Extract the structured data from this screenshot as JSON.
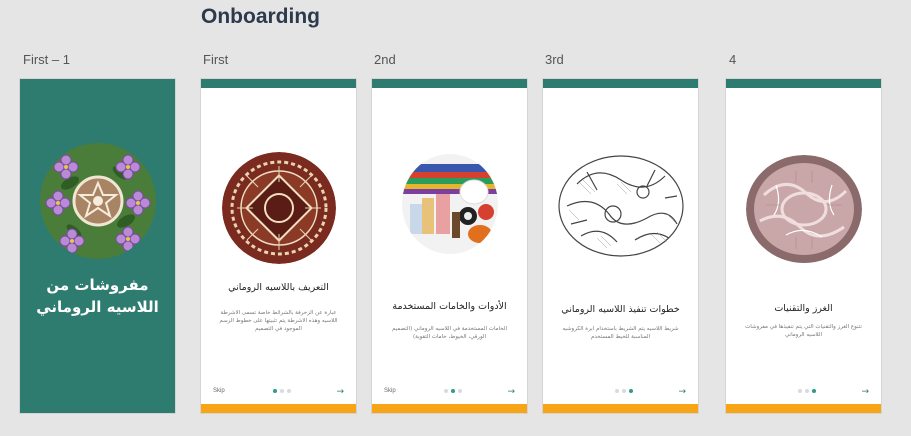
{
  "page": {
    "title": "Onboarding"
  },
  "frames": [
    {
      "label": "First – 1"
    },
    {
      "label": "First"
    },
    {
      "label": "2nd"
    },
    {
      "label": "3rd"
    },
    {
      "label": "4"
    }
  ],
  "splash": {
    "title": "مفروشات من اللاسيه الروماني",
    "image": "lace-flowers-doily"
  },
  "screens": [
    {
      "title": "التعريف باللاسيه الروماني",
      "description": "عبارة عن الزخرفة بالشرائط خاصة تسمى الاشرطة اللاسيه وهذه الاشرطة يتم تثبيتها على خطوط الرسم الموجود في التصميم",
      "skip": "Skip",
      "active_dot": 0,
      "image": "brown-lace-doily"
    },
    {
      "title": "الأدوات والخامات المستخدمة",
      "description": "الخامات المستخدمة في اللاسيه الروماني (التصميم الورقي، الخيوط، خامات التقوية)",
      "skip": "Skip",
      "active_dot": 1,
      "image": "thread-spools"
    },
    {
      "title": "خطوات تنفيذ اللاسيه الروماني",
      "description": "شريط اللاسيه يتم الشريط باستخدام ابرة الكروشيه المناسبة للخيط المستخدم",
      "skip": "",
      "active_dot": 2,
      "image": "lace-pattern-drawing"
    },
    {
      "title": "الغرز والتقنيات",
      "description": "تتنوع الغرز والتقنيات التي يتم تنفيذها في مفروشات اللاسيه الروماني",
      "skip": "",
      "active_dot": 2,
      "image": "pink-lace-piece"
    }
  ],
  "nav": {
    "next_icon": "arrow-right-icon",
    "next_glyph": "→"
  },
  "colors": {
    "teal": "#2e7b70",
    "orange": "#f7a416",
    "dot_active": "#2e9c87",
    "dot_inactive": "#d7dbe0",
    "title": "#2d3a4d"
  }
}
